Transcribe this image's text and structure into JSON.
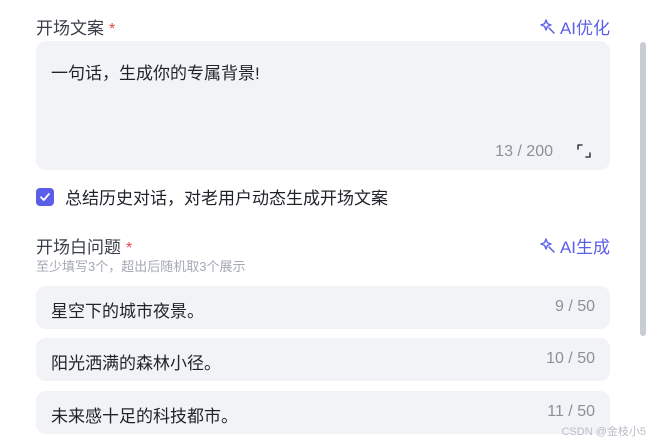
{
  "opening": {
    "label": "开场文案",
    "required_mark": "*",
    "ai_action": "AI优化",
    "text": "一句话，生成你的专属背景!",
    "count": "13 / 200"
  },
  "summary": {
    "checked": true,
    "label": "总结历史对话，对老用户动态生成开场文案"
  },
  "questions": {
    "label": "开场白问题",
    "required_mark": "*",
    "ai_action": "AI生成",
    "hint": "至少填写3个，超出后随机取3个展示",
    "items": [
      {
        "text": "星空下的城市夜景。",
        "count": "9 / 50"
      },
      {
        "text": "阳光洒满的森林小径。",
        "count": "10 / 50"
      },
      {
        "text": "未来感十足的科技都市。",
        "count": "11 / 50"
      }
    ]
  },
  "watermark": "CSDN @金枝小5",
  "colors": {
    "accent": "#5b5ee8",
    "required": "#e5484d",
    "field_bg": "#f2f3f7"
  },
  "icons": {
    "ai": "sparkle-icon",
    "expand": "expand-icon",
    "check": "check-icon"
  }
}
